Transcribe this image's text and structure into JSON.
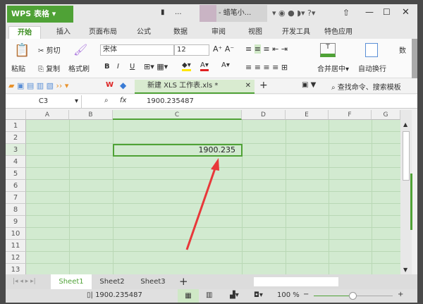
{
  "app": {
    "logo": "WPS 表格",
    "user": "- 蜡笔小...",
    "ellipsis": "..."
  },
  "menu_tabs": [
    "开始",
    "插入",
    "页面布局",
    "公式",
    "数据",
    "审阅",
    "视图",
    "开发工具",
    "特色应用"
  ],
  "ribbon": {
    "paste": "粘贴",
    "cut": "剪切",
    "copy": "复制",
    "format_painter": "格式刷",
    "font": "宋体",
    "font_size": "12",
    "bold": "B",
    "italic": "I",
    "underline": "U",
    "merge": "合并居中",
    "wrap": "自动换行",
    "more": "数"
  },
  "quickbar": {
    "doc_tab": "新建 XLS 工作表.xls *",
    "search": "查找命令、搜索模板"
  },
  "formula_bar": {
    "cell_ref": "C3",
    "fx": "fx",
    "value": "1900.235487"
  },
  "columns": [
    "A",
    "B",
    "C",
    "D",
    "E",
    "F",
    "G"
  ],
  "rows": [
    "1",
    "2",
    "3",
    "4",
    "5",
    "6",
    "7",
    "8",
    "9",
    "10",
    "11",
    "12",
    "13"
  ],
  "cell_c3": "1900.235",
  "sheets": [
    "Sheet1",
    "Sheet2",
    "Sheet3"
  ],
  "status": {
    "value": "1900.235487",
    "zoom": "100 %"
  },
  "colors": {
    "accent": "#4fa236",
    "grid": "#d2ead0",
    "arrow": "#e8383a"
  }
}
